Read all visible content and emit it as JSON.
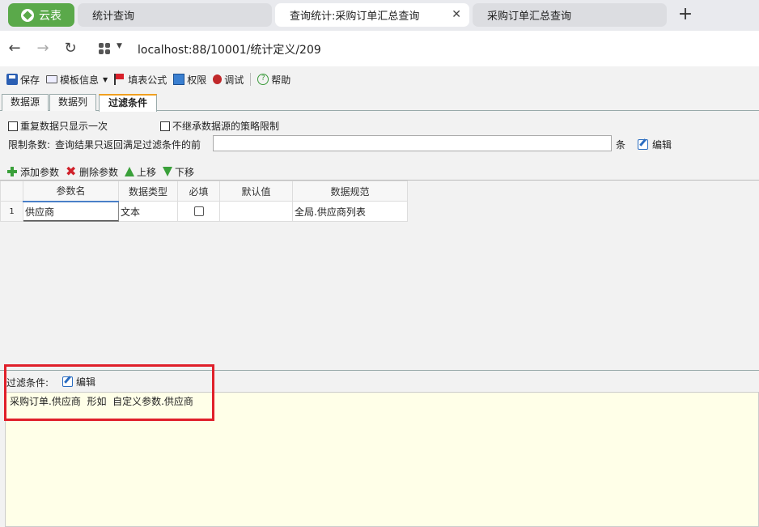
{
  "browser": {
    "brand": "云表",
    "tabs": [
      {
        "label": "统计查询"
      },
      {
        "label": "查询统计:采购订单汇总查询"
      },
      {
        "label": "采购订单汇总查询"
      }
    ],
    "url": "localhost:88/10001/统计定义/209"
  },
  "toolbar": {
    "save": "保存",
    "template": "模板信息",
    "formula": "填表公式",
    "permission": "权限",
    "debug": "调试",
    "help": "帮助"
  },
  "tabs": {
    "datasource": "数据源",
    "columns": "数据列",
    "filter": "过滤条件"
  },
  "options": {
    "repeat_once": "重复数据只显示一次",
    "no_inherit": "不继承数据源的策略限制",
    "limit_label": "限制条数:",
    "limit_desc": "查询结果只返回满足过滤条件的前",
    "limit_value": "",
    "limit_unit": "条",
    "edit": "编辑"
  },
  "param_toolbar": {
    "add": "添加参数",
    "delete": "删除参数",
    "up": "上移",
    "down": "下移"
  },
  "grid": {
    "headers": [
      "参数名",
      "数据类型",
      "必填",
      "默认值",
      "数据规范"
    ],
    "rows": [
      {
        "num": "1",
        "name": "供应商",
        "type": "文本",
        "required": false,
        "default": "",
        "spec": "全局.供应商列表"
      }
    ]
  },
  "filter": {
    "label": "过滤条件:",
    "edit": "编辑",
    "expression": "采购订单.供应商  形如  自定义参数.供应商"
  },
  "colors": {
    "brand": "#5aa94a",
    "highlight": "#e0202a",
    "filter_bg": "#ffffe8"
  }
}
